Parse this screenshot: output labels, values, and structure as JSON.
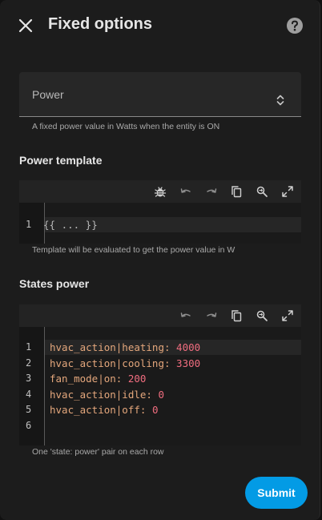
{
  "header": {
    "title": "Fixed options",
    "close_icon": "close-icon",
    "help_icon": "help-icon"
  },
  "power_field": {
    "label": "Power",
    "helper": "A fixed power value in Watts when the entity is ON"
  },
  "power_template": {
    "title": "Power template",
    "line_numbers": [
      "1"
    ],
    "code": "{{ ... }}",
    "helper": "Template will be evaluated to get the power value in W"
  },
  "states_power": {
    "title": "States power",
    "line_numbers": [
      "1",
      "2",
      "3",
      "4",
      "5",
      "6"
    ],
    "lines": [
      {
        "key": "hvac_action|heating: ",
        "value": "4000"
      },
      {
        "key": "hvac_action|cooling: ",
        "value": "3300"
      },
      {
        "key": "fan_mode|on: ",
        "value": "200"
      },
      {
        "key": "hvac_action|idle: ",
        "value": "0"
      },
      {
        "key": "hvac_action|off: ",
        "value": "0"
      },
      {
        "key": "",
        "value": ""
      }
    ],
    "helper": "One 'state: power' pair on each row"
  },
  "submit_label": "Submit",
  "colors": {
    "accent": "#039be5",
    "yaml_key": "#e4a77c",
    "yaml_number": "#f06d7f"
  }
}
